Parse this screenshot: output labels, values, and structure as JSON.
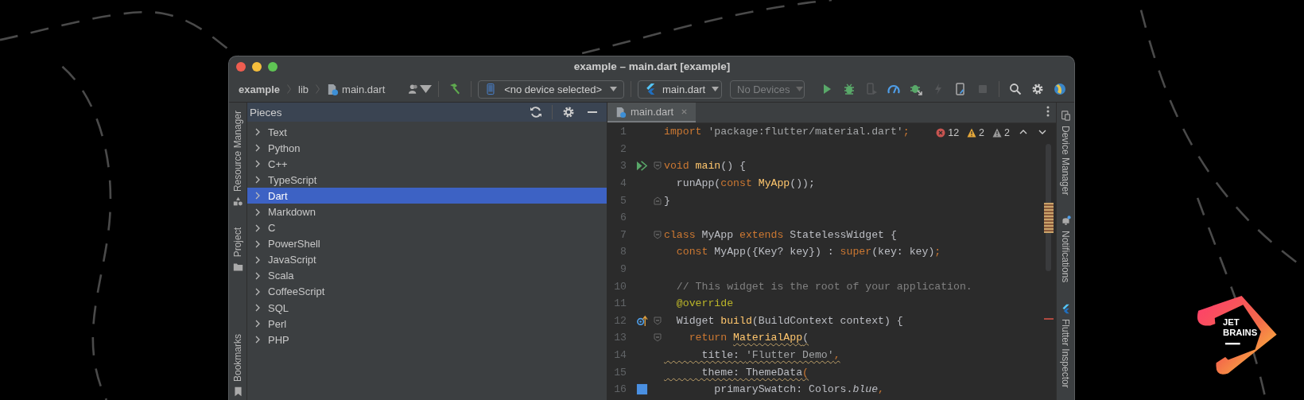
{
  "window": {
    "title": "example – main.dart [example]"
  },
  "breadcrumbs": [
    {
      "label": "example",
      "kind": "project"
    },
    {
      "label": "lib",
      "kind": "folder"
    },
    {
      "label": "main.dart",
      "kind": "file"
    }
  ],
  "toolbar": {
    "device_selector": "<no device selected>",
    "run_config": "main.dart",
    "target": {
      "label": "No Devices",
      "disabled": true
    },
    "actions": [
      {
        "kind": "run",
        "disabled": false
      },
      {
        "kind": "debug",
        "disabled": false
      },
      {
        "kind": "attach",
        "disabled": true
      },
      {
        "kind": "profile",
        "disabled": false
      },
      {
        "kind": "debug-attach",
        "disabled": false
      },
      {
        "kind": "reload",
        "disabled": true
      },
      {
        "kind": "device-file",
        "disabled": false
      },
      {
        "kind": "stop",
        "disabled": true
      }
    ]
  },
  "left_tool_windows": [
    {
      "label": "Resource Manager",
      "kind": "resources"
    },
    {
      "label": "Project",
      "kind": "project"
    },
    {
      "label": "Bookmarks",
      "kind": "bookmarks"
    }
  ],
  "tool_panel": {
    "title": "Pieces",
    "items": [
      {
        "label": "Text",
        "selected": false,
        "expanded": false
      },
      {
        "label": "Python",
        "selected": false,
        "expanded": false
      },
      {
        "label": "C++",
        "selected": false,
        "expanded": false
      },
      {
        "label": "TypeScript",
        "selected": false,
        "expanded": false
      },
      {
        "label": "Dart",
        "selected": true,
        "expanded": false
      },
      {
        "label": "Markdown",
        "selected": false,
        "expanded": false
      },
      {
        "label": "C",
        "selected": false,
        "expanded": false
      },
      {
        "label": "PowerShell",
        "selected": false,
        "expanded": false
      },
      {
        "label": "JavaScript",
        "selected": false,
        "expanded": false
      },
      {
        "label": "Scala",
        "selected": false,
        "expanded": false
      },
      {
        "label": "CoffeeScript",
        "selected": false,
        "expanded": false
      },
      {
        "label": "SQL",
        "selected": false,
        "expanded": false
      },
      {
        "label": "Perl",
        "selected": false,
        "expanded": false
      },
      {
        "label": "PHP",
        "selected": false,
        "expanded": false
      }
    ]
  },
  "editor_tabs": [
    {
      "label": "main.dart",
      "selected": true
    }
  ],
  "inspections": {
    "errors": "12",
    "warnings": "2",
    "weak_warnings": "2"
  },
  "code_lines": [
    {
      "number": "1",
      "tokens": [
        {
          "text": "import",
          "kind": "keyword"
        },
        {
          "text": " 'package:flutter/material.dart'",
          "kind": "string"
        },
        {
          "text": ";",
          "kind": "keyword"
        }
      ]
    },
    {
      "number": "2"
    },
    {
      "number": "3",
      "gutter": {
        "kind": "run"
      },
      "fold": {
        "kind": "start"
      },
      "tokens": [
        {
          "text": "void ",
          "kind": "keyword"
        },
        {
          "text": "main",
          "kind": "function"
        },
        {
          "text": "() {",
          "kind": "plain"
        }
      ]
    },
    {
      "number": "4",
      "tokens": [
        {
          "text": "  runApp(",
          "kind": "plain"
        },
        {
          "text": "const ",
          "kind": "keyword"
        },
        {
          "text": "MyApp",
          "kind": "function"
        },
        {
          "text": "());",
          "kind": "plain"
        }
      ]
    },
    {
      "number": "5",
      "fold": {
        "kind": "end"
      },
      "tokens": [
        {
          "text": "}",
          "kind": "plain"
        }
      ]
    },
    {
      "number": "6"
    },
    {
      "number": "7",
      "fold": {
        "kind": "start"
      },
      "tokens": [
        {
          "text": "class ",
          "kind": "keyword"
        },
        {
          "text": "MyApp ",
          "kind": "plain"
        },
        {
          "text": "extends ",
          "kind": "keyword"
        },
        {
          "text": "StatelessWidget {",
          "kind": "plain"
        }
      ]
    },
    {
      "number": "8",
      "tokens": [
        {
          "text": "  const ",
          "kind": "keyword"
        },
        {
          "text": "MyApp({Key? key}) : ",
          "kind": "plain"
        },
        {
          "text": "super",
          "kind": "keyword"
        },
        {
          "text": "(key: key)",
          "kind": "plain"
        },
        {
          "text": ";",
          "kind": "keyword"
        }
      ]
    },
    {
      "number": "9"
    },
    {
      "number": "10",
      "tokens": [
        {
          "text": "  // This widget is the root of your application.",
          "kind": "comment"
        }
      ]
    },
    {
      "number": "11",
      "tokens": [
        {
          "text": "  @override",
          "kind": "annotation"
        }
      ]
    },
    {
      "number": "12",
      "gutter": {
        "kind": "override"
      },
      "fold": {
        "kind": "start"
      },
      "tokens": [
        {
          "text": "  Widget ",
          "kind": "plain"
        },
        {
          "text": "build",
          "kind": "function"
        },
        {
          "text": "(BuildContext context) {",
          "kind": "plain"
        }
      ]
    },
    {
      "number": "13",
      "fold": {
        "kind": "start"
      },
      "tokens": [
        {
          "text": "    return ",
          "kind": "keyword"
        },
        {
          "text": "MaterialApp",
          "kind": "function",
          "squiggly": true
        },
        {
          "text": "(",
          "kind": "plain",
          "squiggly": true
        }
      ]
    },
    {
      "number": "14",
      "tokens": [
        {
          "text": "      title: ",
          "kind": "plain",
          "squiggly": true
        },
        {
          "text": "'Flutter Demo'",
          "kind": "string",
          "squiggly": true
        },
        {
          "text": ",",
          "kind": "keyword",
          "squiggly": true
        }
      ]
    },
    {
      "number": "15",
      "tokens": [
        {
          "text": "      theme: ThemeData",
          "kind": "plain",
          "squiggly": true
        },
        {
          "text": "(",
          "kind": "keyword",
          "squiggly": true
        }
      ]
    },
    {
      "number": "16",
      "gutter": {
        "kind": "color"
      },
      "tokens": [
        {
          "text": "        primarySwatch: Colors.",
          "kind": "plain"
        },
        {
          "text": "blue",
          "kind": "italic"
        },
        {
          "text": ",",
          "kind": "keyword"
        }
      ]
    }
  ],
  "right_tool_windows": [
    {
      "label": "Device Manager",
      "kind": "devices"
    },
    {
      "label": "Notifications",
      "kind": "notifications"
    },
    {
      "label": "Flutter Inspector",
      "kind": "flutter"
    }
  ],
  "logo": {
    "lines": [
      "JET",
      "BRAINS"
    ]
  }
}
